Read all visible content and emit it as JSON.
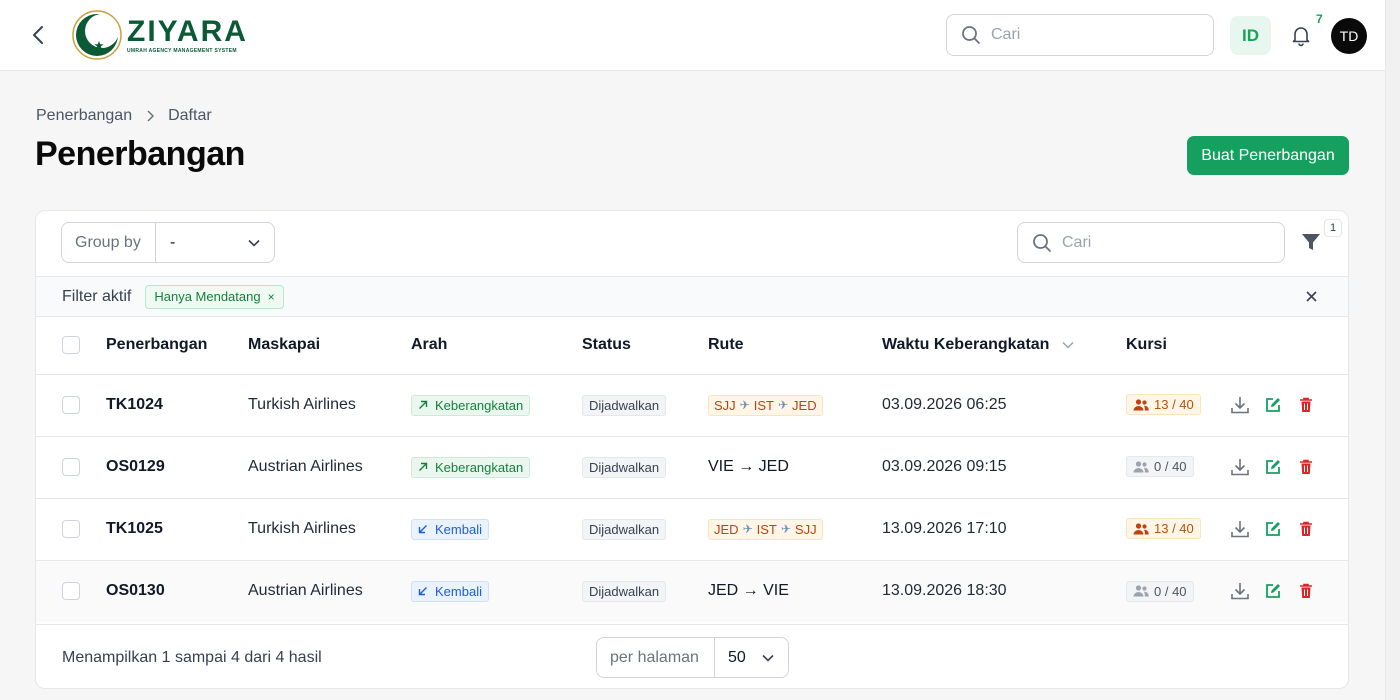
{
  "topbar": {
    "logo_name": "ZIYARA",
    "logo_sub": "UMRAH AGENCY MANAGEMENT SYSTEM",
    "search_placeholder": "Cari",
    "lang": "ID",
    "notification_count": "7",
    "avatar_initials": "TD"
  },
  "breadcrumb": {
    "parent": "Penerbangan",
    "current": "Daftar"
  },
  "page": {
    "title": "Penerbangan",
    "create_button": "Buat Penerbangan"
  },
  "toolbar": {
    "groupby_label": "Group by",
    "groupby_value": "-",
    "search_placeholder": "Cari",
    "filter_count": "1"
  },
  "active_filters": {
    "label": "Filter aktif",
    "chips": [
      "Hanya Mendatang"
    ]
  },
  "table": {
    "columns": {
      "flight": "Penerbangan",
      "airline": "Maskapai",
      "direction": "Arah",
      "status": "Status",
      "route": "Rute",
      "departure": "Waktu Keberangkatan",
      "seats": "Kursi"
    },
    "rows": [
      {
        "code": "TK1024",
        "airline": "Turkish Airlines",
        "direction": "Keberangkatan",
        "status": "Dijadwalkan",
        "route_stops": [
          "SJJ",
          "IST",
          "JED"
        ],
        "route_text": "",
        "departure": "03.09.2026 06:25",
        "seats": "13 / 40"
      },
      {
        "code": "OS0129",
        "airline": "Austrian Airlines",
        "direction": "Keberangkatan",
        "status": "Dijadwalkan",
        "route_stops": [],
        "route_text": "VIE → JED",
        "departure": "03.09.2026 09:15",
        "seats": "0 / 40"
      },
      {
        "code": "TK1025",
        "airline": "Turkish Airlines",
        "direction": "Kembali",
        "status": "Dijadwalkan",
        "route_stops": [
          "JED",
          "IST",
          "SJJ"
        ],
        "route_text": "",
        "departure": "13.09.2026 17:10",
        "seats": "13 / 40"
      },
      {
        "code": "OS0130",
        "airline": "Austrian Airlines",
        "direction": "Kembali",
        "status": "Dijadwalkan",
        "route_stops": [],
        "route_text": "JED → VIE",
        "departure": "13.09.2026 18:30",
        "seats": "0 / 40"
      }
    ]
  },
  "footer": {
    "summary": "Menampilkan 1 sampai 4 dari 4 hasil",
    "per_page_label": "per halaman",
    "per_page_value": "50"
  },
  "colors": {
    "brand": "#16a060",
    "logo": "#0b5a35",
    "danger": "#dc2626"
  }
}
